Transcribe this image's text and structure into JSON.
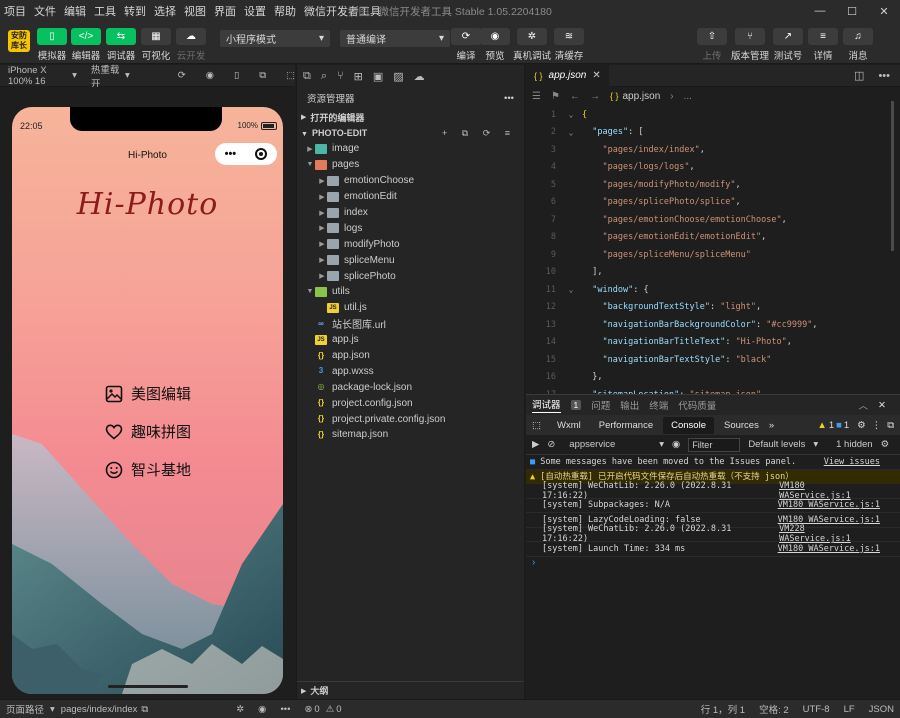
{
  "menu": {
    "items": [
      "项目",
      "文件",
      "编辑",
      "工具",
      "转到",
      "选择",
      "视图",
      "界面",
      "设置",
      "帮助",
      "微信开发者工具"
    ],
    "title": "拼图 - 微信开发者工具 Stable 1.05.2204180"
  },
  "toolbar": {
    "logo": "安防库长",
    "simulator": "模拟器",
    "editor": "编辑器",
    "debugger": "调试器",
    "visual": "可视化",
    "cloud": "云开发",
    "mode": "小程序模式",
    "compile": "普通编译",
    "compile_btn": "编译",
    "preview": "预览",
    "realdebug": "真机调试",
    "clearcache": "清缓存",
    "upload": "上传",
    "version": "版本管理",
    "test": "测试号",
    "detail": "详情",
    "message": "消息"
  },
  "simbar": {
    "device": "iPhone X 100% 16",
    "hotreload": "热重载 开"
  },
  "phone": {
    "time": "22:05",
    "battery": "100%",
    "nav_title": "Hi-Photo",
    "app_title": "Hi-Photo",
    "menu": [
      "美图编辑",
      "趣味拼图",
      "智斗基地"
    ]
  },
  "explorer": {
    "title": "资源管理器",
    "open_editors": "打开的编辑器",
    "project": "PHOTO-EDIT",
    "outline": "大纲",
    "tree": [
      {
        "name": "image",
        "depth": 0,
        "type": "folder-teal",
        "arrow": "▶"
      },
      {
        "name": "pages",
        "depth": 0,
        "type": "folder-red",
        "arrow": "▼"
      },
      {
        "name": "emotionChoose",
        "depth": 1,
        "type": "folder",
        "arrow": "▶"
      },
      {
        "name": "emotionEdit",
        "depth": 1,
        "type": "folder",
        "arrow": "▶"
      },
      {
        "name": "index",
        "depth": 1,
        "type": "folder",
        "arrow": "▶"
      },
      {
        "name": "logs",
        "depth": 1,
        "type": "folder",
        "arrow": "▶"
      },
      {
        "name": "modifyPhoto",
        "depth": 1,
        "type": "folder",
        "arrow": "▶"
      },
      {
        "name": "spliceMenu",
        "depth": 1,
        "type": "folder",
        "arrow": "▶"
      },
      {
        "name": "splicePhoto",
        "depth": 1,
        "type": "folder",
        "arrow": "▶"
      },
      {
        "name": "utils",
        "depth": 0,
        "type": "folder-green",
        "arrow": "▼"
      },
      {
        "name": "util.js",
        "depth": 1,
        "type": "js",
        "arrow": ""
      },
      {
        "name": "站长图库.url",
        "depth": 0,
        "type": "link",
        "arrow": ""
      },
      {
        "name": "app.js",
        "depth": 0,
        "type": "js",
        "arrow": ""
      },
      {
        "name": "app.json",
        "depth": 0,
        "type": "json",
        "arrow": ""
      },
      {
        "name": "app.wxss",
        "depth": 0,
        "type": "css",
        "arrow": ""
      },
      {
        "name": "package-lock.json",
        "depth": 0,
        "type": "pkg",
        "arrow": ""
      },
      {
        "name": "project.config.json",
        "depth": 0,
        "type": "json",
        "arrow": ""
      },
      {
        "name": "project.private.config.json",
        "depth": 0,
        "type": "json",
        "arrow": ""
      },
      {
        "name": "sitemap.json",
        "depth": 0,
        "type": "json",
        "arrow": ""
      }
    ]
  },
  "editor": {
    "tab": "app.json",
    "breadcrumb": "app.json",
    "lines": [
      {
        "n": "1",
        "fold": "⌄",
        "html": "<span class='y'>{</span>"
      },
      {
        "n": "2",
        "fold": "⌄",
        "html": "  <span class='k'>\"pages\"</span><span class='p'>: [</span>"
      },
      {
        "n": "3",
        "fold": "",
        "html": "    <span class='s'>\"pages/index/index\"</span><span class='p'>,</span>"
      },
      {
        "n": "4",
        "fold": "",
        "html": "    <span class='s'>\"pages/logs/logs\"</span><span class='p'>,</span>"
      },
      {
        "n": "5",
        "fold": "",
        "html": "    <span class='s'>\"pages/modifyPhoto/modify\"</span><span class='p'>,</span>"
      },
      {
        "n": "6",
        "fold": "",
        "html": "    <span class='s'>\"pages/splicePhoto/splice\"</span><span class='p'>,</span>"
      },
      {
        "n": "7",
        "fold": "",
        "html": "    <span class='s'>\"pages/emotionChoose/emotionChoose\"</span><span class='p'>,</span>"
      },
      {
        "n": "8",
        "fold": "",
        "html": "    <span class='s'>\"pages/emotionEdit/emotionEdit\"</span><span class='p'>,</span>"
      },
      {
        "n": "9",
        "fold": "",
        "html": "    <span class='s'>\"pages/spliceMenu/spliceMenu\"</span>"
      },
      {
        "n": "10",
        "fold": "",
        "html": "  <span class='p'>],</span>"
      },
      {
        "n": "11",
        "fold": "⌄",
        "html": "  <span class='k'>\"window\"</span><span class='p'>: {</span>"
      },
      {
        "n": "12",
        "fold": "",
        "html": "    <span class='k'>\"backgroundTextStyle\"</span><span class='p'>: </span><span class='s'>\"light\"</span><span class='p'>,</span>"
      },
      {
        "n": "13",
        "fold": "",
        "html": "    <span class='k'>\"navigationBarBackgroundColor\"</span><span class='p'>: </span><span class='s'>\"#cc9999\"</span><span class='p'>,</span>"
      },
      {
        "n": "14",
        "fold": "",
        "html": "    <span class='k'>\"navigationBarTitleText\"</span><span class='p'>: </span><span class='s'>\"Hi-Photo\"</span><span class='p'>,</span>"
      },
      {
        "n": "15",
        "fold": "",
        "html": "    <span class='k'>\"navigationBarTextStyle\"</span><span class='p'>: </span><span class='s'>\"black\"</span>"
      },
      {
        "n": "16",
        "fold": "",
        "html": "  <span class='p'>},</span>"
      },
      {
        "n": "17",
        "fold": "",
        "html": "  <span class='k'>\"sitemapLocation\"</span><span class='p'>: </span><span class='s'>\"sitemap.json\"</span>"
      }
    ]
  },
  "debug": {
    "tabs": [
      "调试器",
      "问题",
      "输出",
      "终端",
      "代码质量"
    ],
    "badge": "1",
    "ctabs": [
      "Wxml",
      "Performance",
      "Console",
      "Sources"
    ],
    "context": "appservice",
    "filter": "Filter",
    "levels": "Default levels",
    "hidden": "1 hidden",
    "warn_count": "1",
    "info_count": "1",
    "logs": [
      {
        "kind": "info",
        "text": "Some messages have been moved to the Issues panel.",
        "src": "View issues"
      },
      {
        "kind": "warn",
        "text": "[自动热重载] 已开启代码文件保存后自动热重载（不支持 json）",
        "src": ""
      },
      {
        "kind": "",
        "text": "[system] WeChatLib: 2.26.0 (2022.8.31 17:16:22)",
        "src": "VM180 WAService.js:1"
      },
      {
        "kind": "",
        "text": "[system] Subpackages: N/A",
        "src": "VM180 WAService.js:1"
      },
      {
        "kind": "",
        "text": "[system] LazyCodeLoading: false",
        "src": "VM180 WAService.js:1"
      },
      {
        "kind": "",
        "text": "[system] WeChatLib: 2.26.0 (2022.8.31 17:16:22)",
        "src": "VM228 WAService.js:1"
      },
      {
        "kind": "",
        "text": "[system] Launch Time: 334 ms",
        "src": "VM180 WAService.js:1"
      }
    ]
  },
  "status": {
    "path_label": "页面路径",
    "path": "pages/index/index",
    "errors": "0",
    "warnings": "0",
    "position": "行 1，列 1",
    "spaces": "空格: 2",
    "encoding": "UTF-8",
    "eol": "LF",
    "lang": "JSON"
  }
}
